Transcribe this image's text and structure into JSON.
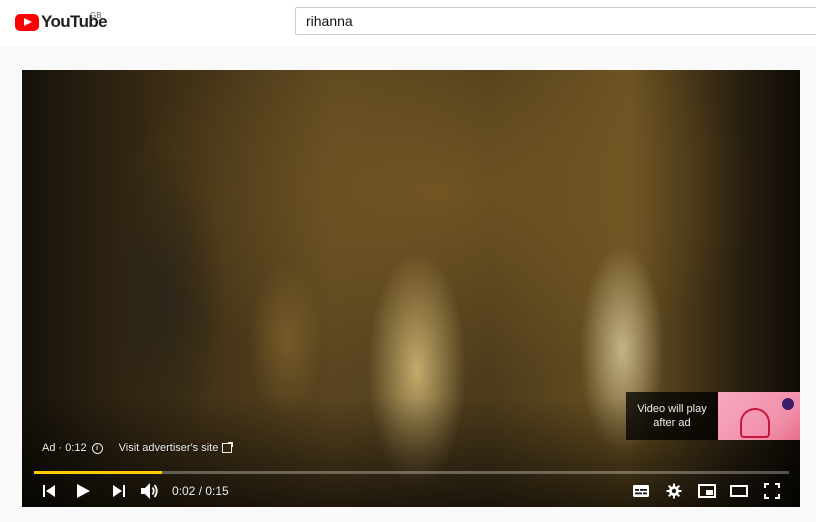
{
  "header": {
    "logo_text": "YouTube",
    "country_code": "GB",
    "search_value": "rihanna"
  },
  "player": {
    "ad_label": "Ad · 0:12",
    "advertiser_link": "Visit advertiser's site",
    "next_video_label": "Video will play after ad",
    "current_time": "0:02",
    "duration": "0:15",
    "time_display": "0:02 / 0:15",
    "progress_fraction": 0.17,
    "progress_color": "#ffcc00",
    "icons": [
      "previous-icon",
      "play-icon",
      "next-icon",
      "volume-icon",
      "subtitles-icon",
      "settings-icon",
      "miniplayer-icon",
      "theater-mode-icon",
      "fullscreen-icon"
    ]
  }
}
